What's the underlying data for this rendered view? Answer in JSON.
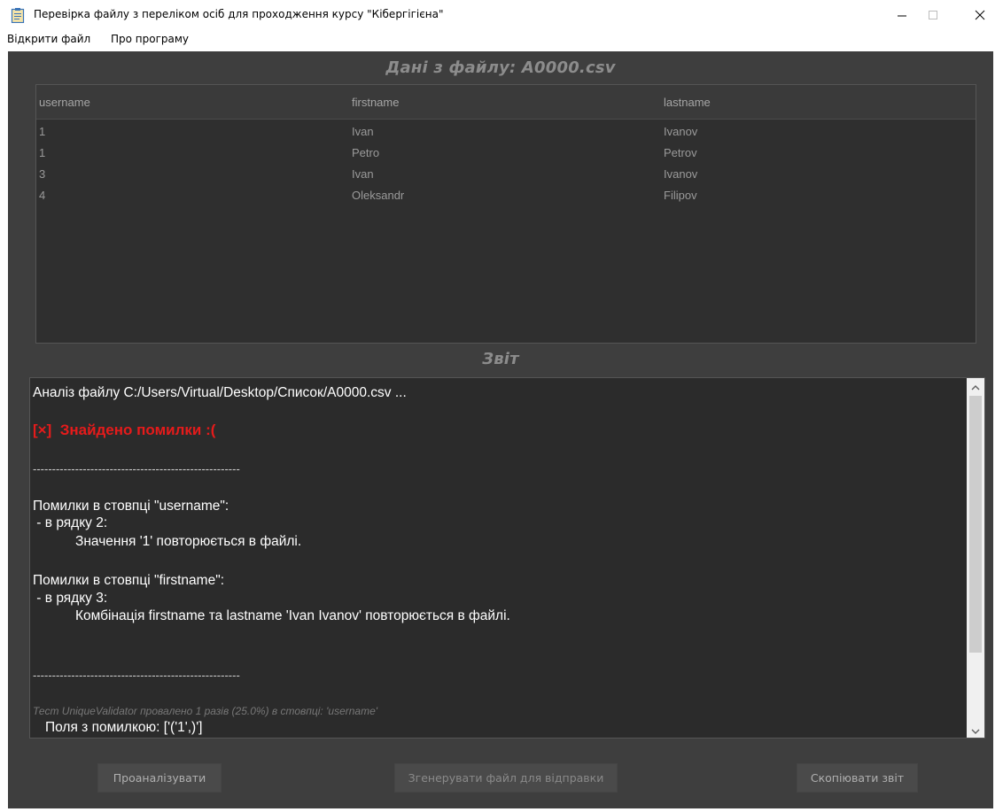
{
  "window": {
    "title": "Перевірка файлу з переліком осіб для проходження курсу \"Кібергігієна\"",
    "icon": "clipboard-icon"
  },
  "menu": {
    "open_file": "Відкрити файл",
    "about": "Про програму"
  },
  "data_section": {
    "title": "Дані з файлу: A0000.csv",
    "columns": [
      "username",
      "firstname",
      "lastname"
    ],
    "rows": [
      [
        "1",
        "Ivan",
        "Ivanov"
      ],
      [
        "1",
        "Petro",
        "Petrov"
      ],
      [
        "3",
        "Ivan",
        "Ivanov"
      ],
      [
        "4",
        "Oleksandr",
        "Filipov"
      ]
    ]
  },
  "report_section": {
    "title": "Звіт",
    "lines": {
      "analysis": "Аналіз файлу C:/Users/Virtual/Desktop/Список/A0000.csv ...",
      "errors_found": "[×]  Знайдено помилки :(",
      "separator": "------------------------------------------------------",
      "col1_header": "Помилки в стовпці \"username\":",
      "col1_row": " - в рядку 2:",
      "col1_msg": "Значення '1' повторюється в файлі.",
      "col2_header": "Помилки в стовпці \"firstname\":",
      "col2_row": " - в рядку 3:",
      "col2_msg": "Комбінація firstname та lastname 'Ivan Ivanov' повторюється в файлі.",
      "test_info": "Тест UniqueValidator провалено 1 разів (25.0%) в стовпці: 'username'",
      "fields_error": "Поля з помилкою: ['('1',)']"
    }
  },
  "buttons": {
    "analyze": "Проаналізувати",
    "generate": "Згенерувати файл для відправки",
    "copy": "Скопіювати звіт"
  },
  "colors": {
    "panel_bg": "#3e3e3e",
    "report_bg": "#2b2b2b",
    "error_red": "#e51b1b"
  }
}
